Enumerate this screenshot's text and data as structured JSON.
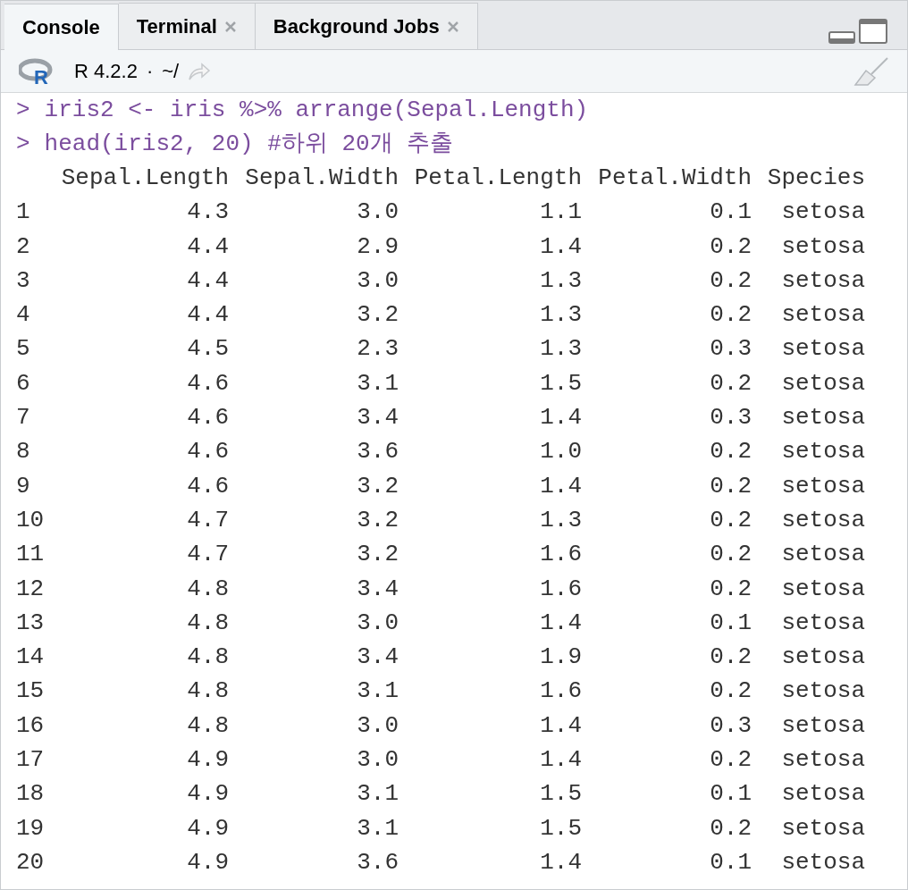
{
  "tabs": [
    {
      "label": "Console",
      "selected": true,
      "closable": false
    },
    {
      "label": "Terminal",
      "selected": false,
      "closable": true
    },
    {
      "label": "Background Jobs",
      "selected": false,
      "closable": true
    }
  ],
  "toolbar": {
    "logo": "R",
    "version": "R 4.2.2",
    "separator": "·",
    "path": "~/"
  },
  "console": {
    "commands": [
      {
        "prompt": ">",
        "code": "iris2 <- iris %>% arrange(Sepal.Length)"
      },
      {
        "prompt": ">",
        "code": "head(iris2, 20) #하위 20개 추출"
      }
    ],
    "table": {
      "columns": [
        "",
        "Sepal.Length",
        "Sepal.Width",
        "Petal.Length",
        "Petal.Width",
        "Species"
      ],
      "rows": [
        [
          "1",
          "4.3",
          "3.0",
          "1.1",
          "0.1",
          "setosa"
        ],
        [
          "2",
          "4.4",
          "2.9",
          "1.4",
          "0.2",
          "setosa"
        ],
        [
          "3",
          "4.4",
          "3.0",
          "1.3",
          "0.2",
          "setosa"
        ],
        [
          "4",
          "4.4",
          "3.2",
          "1.3",
          "0.2",
          "setosa"
        ],
        [
          "5",
          "4.5",
          "2.3",
          "1.3",
          "0.3",
          "setosa"
        ],
        [
          "6",
          "4.6",
          "3.1",
          "1.5",
          "0.2",
          "setosa"
        ],
        [
          "7",
          "4.6",
          "3.4",
          "1.4",
          "0.3",
          "setosa"
        ],
        [
          "8",
          "4.6",
          "3.6",
          "1.0",
          "0.2",
          "setosa"
        ],
        [
          "9",
          "4.6",
          "3.2",
          "1.4",
          "0.2",
          "setosa"
        ],
        [
          "10",
          "4.7",
          "3.2",
          "1.3",
          "0.2",
          "setosa"
        ],
        [
          "11",
          "4.7",
          "3.2",
          "1.6",
          "0.2",
          "setosa"
        ],
        [
          "12",
          "4.8",
          "3.4",
          "1.6",
          "0.2",
          "setosa"
        ],
        [
          "13",
          "4.8",
          "3.0",
          "1.4",
          "0.1",
          "setosa"
        ],
        [
          "14",
          "4.8",
          "3.4",
          "1.9",
          "0.2",
          "setosa"
        ],
        [
          "15",
          "4.8",
          "3.1",
          "1.6",
          "0.2",
          "setosa"
        ],
        [
          "16",
          "4.8",
          "3.0",
          "1.4",
          "0.3",
          "setosa"
        ],
        [
          "17",
          "4.9",
          "3.0",
          "1.4",
          "0.2",
          "setosa"
        ],
        [
          "18",
          "4.9",
          "3.1",
          "1.5",
          "0.1",
          "setosa"
        ],
        [
          "19",
          "4.9",
          "3.1",
          "1.5",
          "0.2",
          "setosa"
        ],
        [
          "20",
          "4.9",
          "3.6",
          "1.4",
          "0.1",
          "setosa"
        ]
      ]
    }
  }
}
